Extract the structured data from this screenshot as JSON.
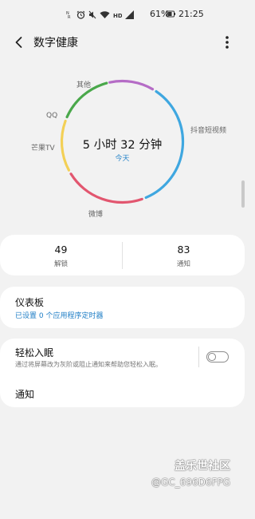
{
  "status_bar": {
    "battery": "61%",
    "time": "21:25",
    "icons": [
      "nfc-icon",
      "alarm-icon",
      "mute-icon",
      "wifi-icon",
      "hd-icon",
      "signal-icon",
      "battery-icon"
    ]
  },
  "header": {
    "title": "数字健康",
    "back_icon": "back-arrow-icon",
    "more_icon": "more-vert-icon"
  },
  "usage": {
    "total": "5 小时 32 分钟",
    "period": "今天",
    "categories": [
      {
        "name": "其他",
        "color": "#b56cc6"
      },
      {
        "name": "抖音短视频",
        "color": "#3fa7e0"
      },
      {
        "name": "微博",
        "color": "#e2566f"
      },
      {
        "name": "芒果TV",
        "color": "#f3d056"
      },
      {
        "name": "QQ",
        "color": "#4aa84b"
      }
    ]
  },
  "stats": {
    "unlocks": {
      "value": "49",
      "label": "解锁"
    },
    "notifications": {
      "value": "83",
      "label": "通知"
    }
  },
  "dashboard": {
    "title": "仪表板",
    "subtitle": "已设置 0 个应用程序定时器"
  },
  "wind_down": {
    "title": "轻松入眠",
    "description": "通过将屏幕改为灰阶或阻止通知来帮助您轻松入眠。",
    "enabled": false
  },
  "notifications_item": {
    "title": "通知"
  },
  "watermark": {
    "line1": "盖乐世社区",
    "line2": "@GC_696D6FPG"
  },
  "colors": {
    "accent": "#1f7ec6",
    "background": "#f2f2f2",
    "card": "#ffffff"
  }
}
